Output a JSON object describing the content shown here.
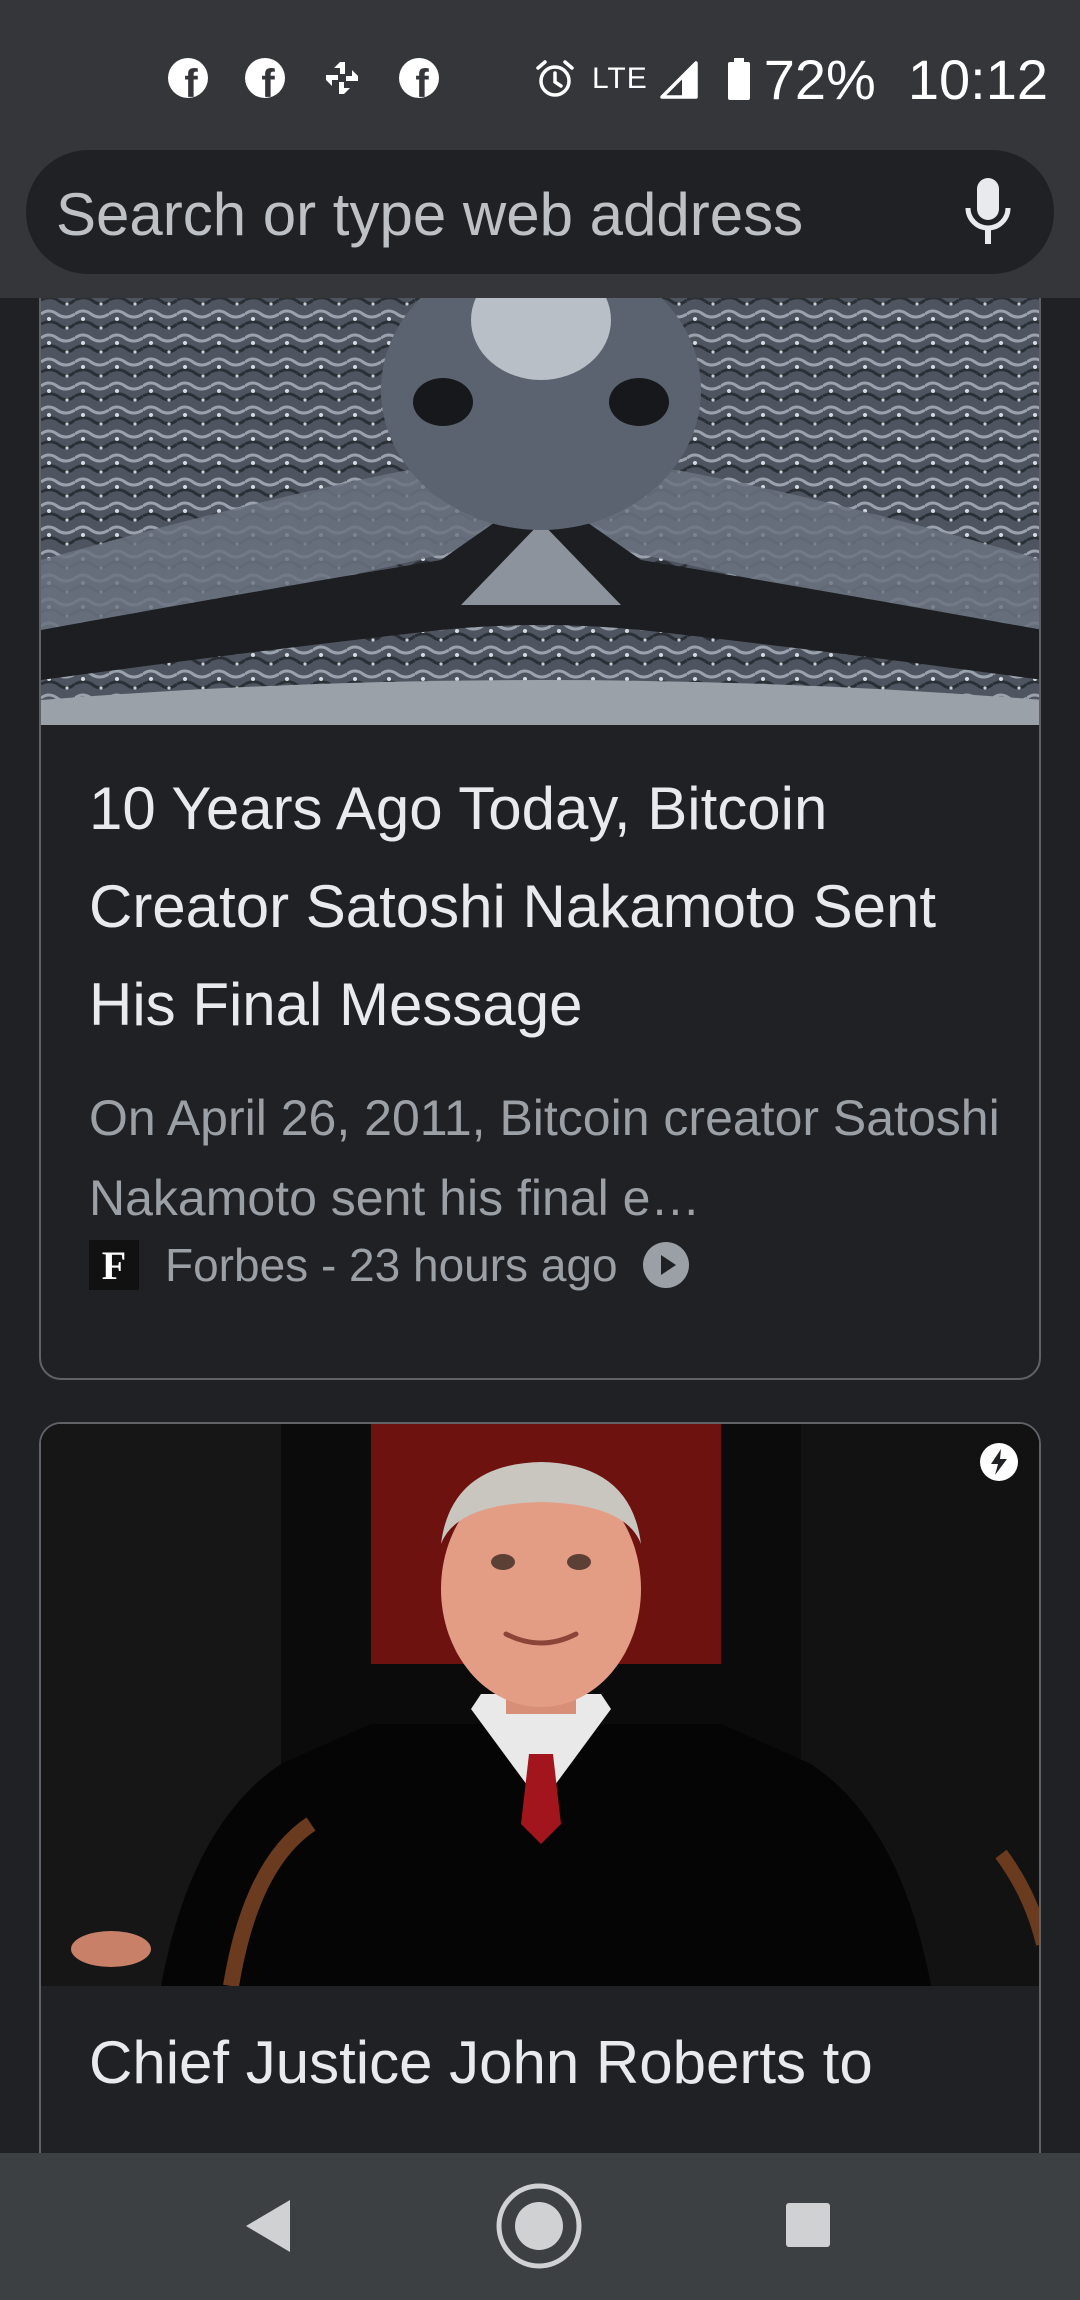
{
  "status_bar": {
    "notification_icons": [
      "facebook-icon",
      "facebook-icon",
      "pinwheel-icon",
      "facebook-icon"
    ],
    "alarm_icon": "alarm-clock-icon",
    "network": "LTE",
    "signal_icon": "signal-icon",
    "battery_icon": "battery-icon",
    "battery": "72%",
    "time": "10:12"
  },
  "search": {
    "placeholder": "Search or type web address",
    "mic_icon": "microphone-icon"
  },
  "feed": {
    "articles": [
      {
        "title": "10 Years Ago Today, Bitcoin Creator Satoshi Nakamoto Sent His Final Message",
        "snippet": "On April 26, 2011, Bitcoin creator Satoshi Nakamoto sent his final e…",
        "publisher_logo": "F",
        "meta": "Forbes - 23 hours ago",
        "meta_icon": "play-circle-icon"
      },
      {
        "title": "Chief Justice John Roberts to",
        "badge_icon": "amp-lightning-icon"
      }
    ]
  },
  "nav_bar": {
    "back_icon": "back-triangle-icon",
    "home_icon": "home-circle-icon",
    "recents_icon": "recents-square-icon"
  },
  "colors": {
    "chrome_bar": "#35363a",
    "page_background": "#202124",
    "nav_bar": "#3c4043",
    "card_border": "#5f6368",
    "primary_text": "#e8eaed",
    "secondary_text": "#9aa0a6"
  }
}
